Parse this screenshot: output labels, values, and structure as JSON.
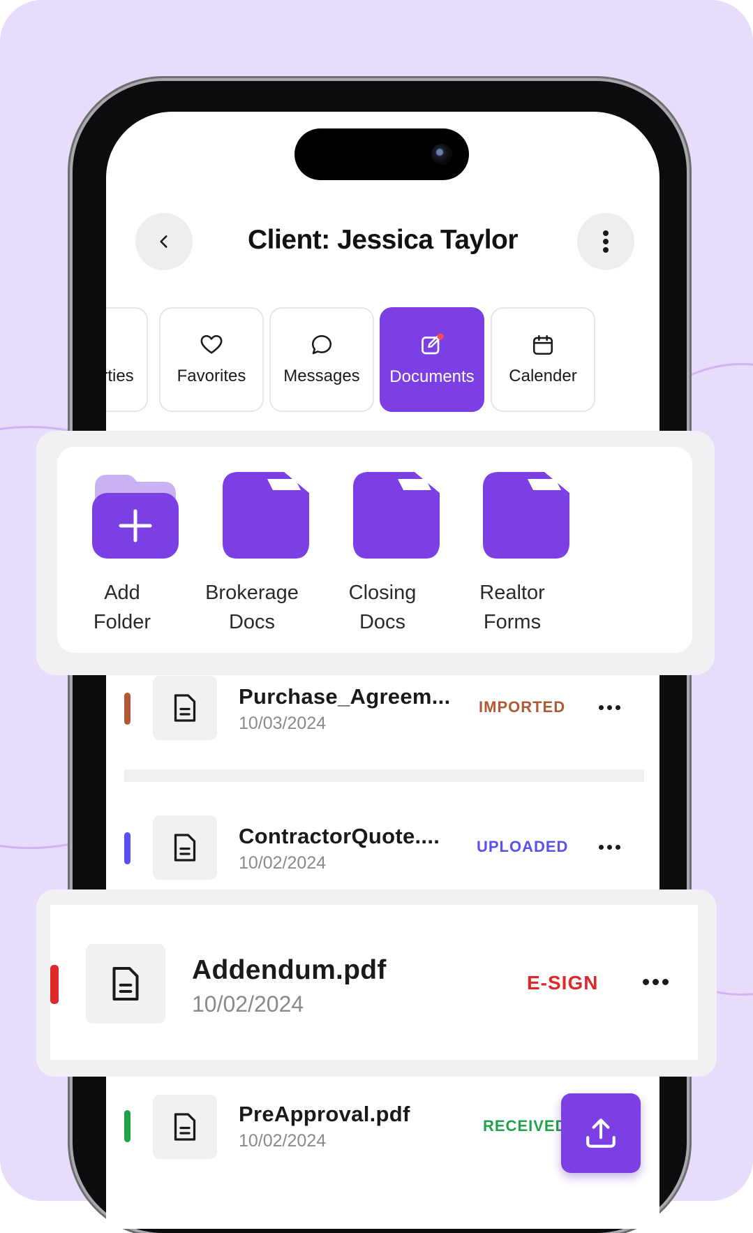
{
  "header": {
    "title": "Client: Jessica Taylor"
  },
  "tabs": [
    {
      "label": "Properties",
      "icon": "home-icon",
      "active": false
    },
    {
      "label": "Favorites",
      "icon": "heart-icon",
      "active": false
    },
    {
      "label": "Messages",
      "icon": "chat-icon",
      "active": false
    },
    {
      "label": "Documents",
      "icon": "edit-document-icon",
      "active": true
    },
    {
      "label": "Calender",
      "icon": "calendar-icon",
      "active": false
    }
  ],
  "folders": [
    {
      "line1": "Add",
      "line2": "Folder",
      "icon": "add-folder-icon"
    },
    {
      "line1": "Brokerage",
      "line2": "Docs",
      "icon": "folder-icon"
    },
    {
      "line1": "Closing",
      "line2": "Docs",
      "icon": "folder-icon"
    },
    {
      "line1": "Realtor",
      "line2": "Forms",
      "icon": "folder-icon"
    }
  ],
  "documents": [
    {
      "name": "Purchase_Agreem...",
      "date": "10/03/2024",
      "status": "IMPORTED",
      "color": "#b05a35"
    },
    {
      "name": "ContractorQuote....",
      "date": "10/02/2024",
      "status": "UPLOADED",
      "color": "#5a4ff0"
    },
    {
      "name": "Addendum.pdf",
      "date": "10/02/2024",
      "status": "E-SIGN",
      "color": "#e02828"
    },
    {
      "name": "PreApproval.pdf",
      "date": "10/02/2024",
      "status": "RECEIVED",
      "color": "#1fa34a"
    }
  ],
  "colors": {
    "accent": "#7b3fe4",
    "background": "#e8dcfb"
  }
}
